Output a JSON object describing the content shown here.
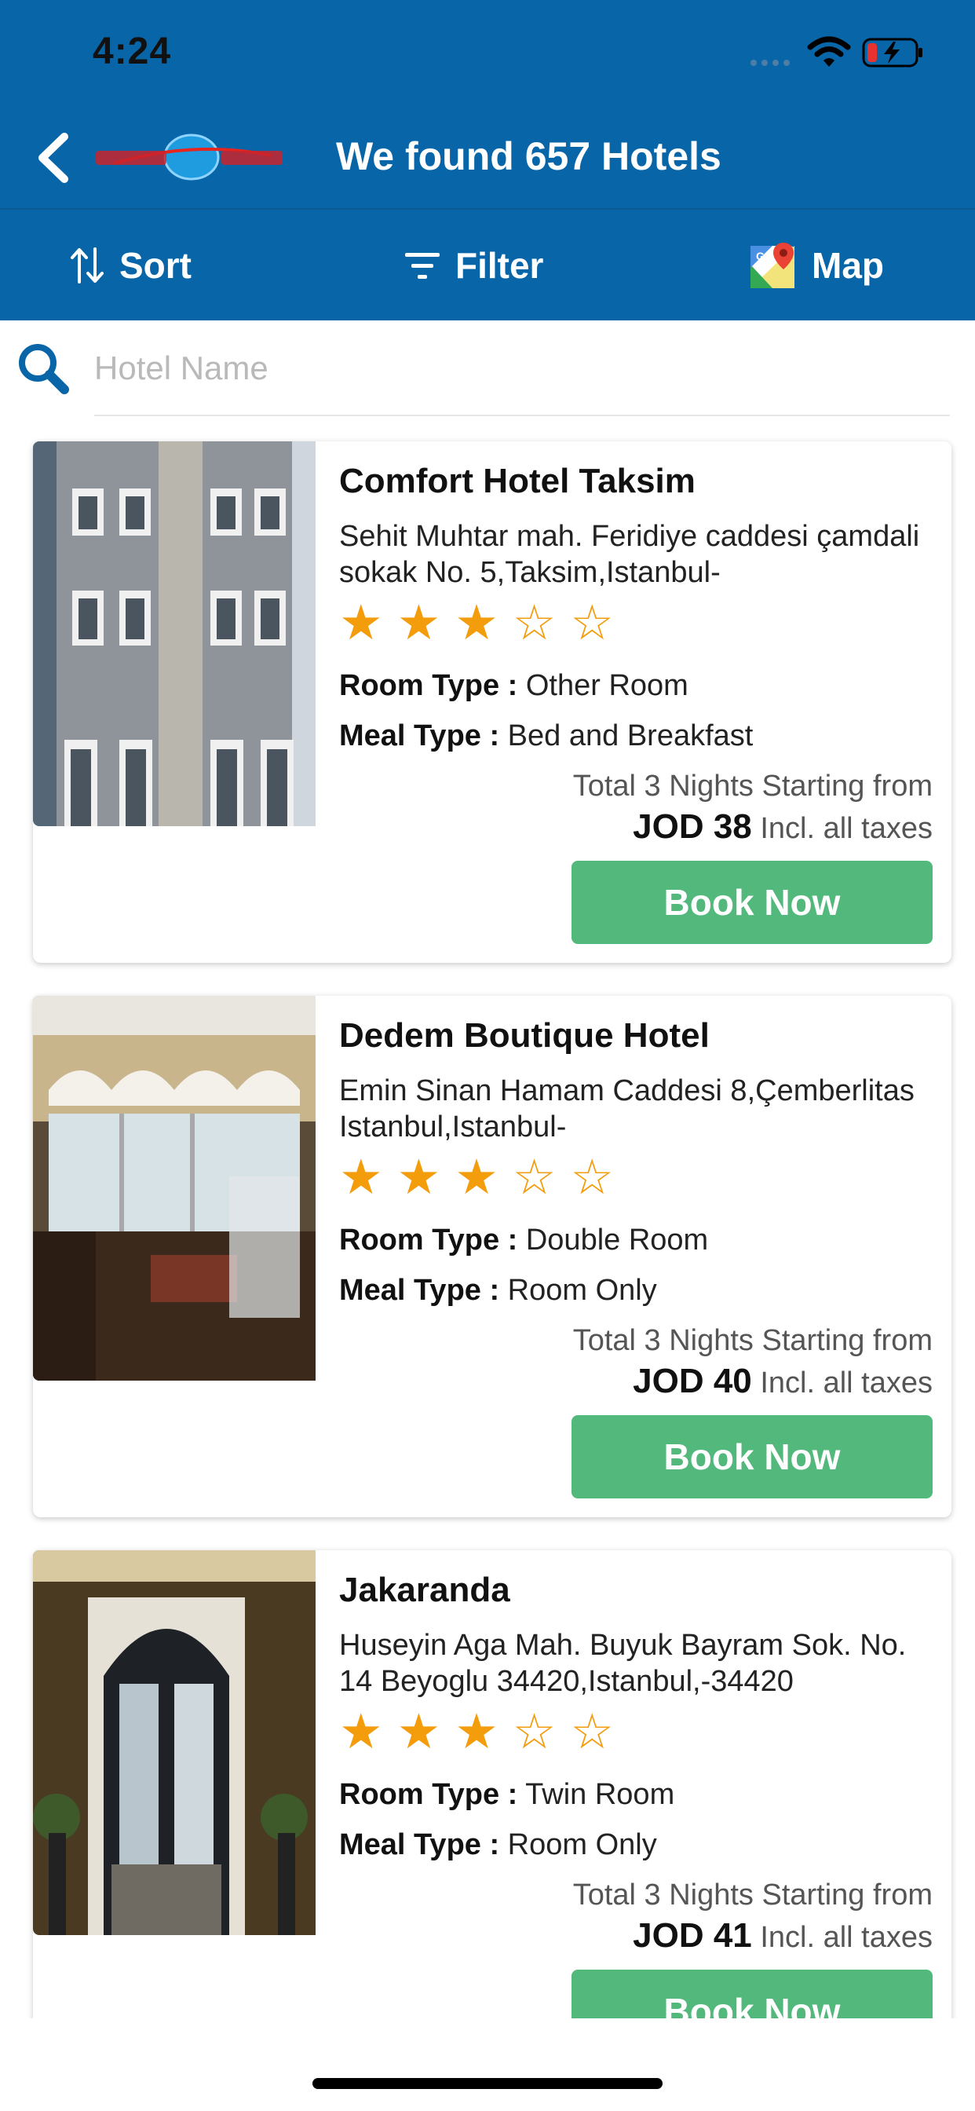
{
  "status": {
    "time": "4:24"
  },
  "header": {
    "title": "We found 657 Hotels",
    "logo_alt": "Dallas"
  },
  "toolbar": {
    "sort": "Sort",
    "filter": "Filter",
    "map": "Map"
  },
  "search": {
    "placeholder": "Hotel Name",
    "value": ""
  },
  "colors": {
    "brand": "#0765a8",
    "book_button": "#52b87b",
    "star": "#f39c0c"
  },
  "hotels": [
    {
      "name": "Comfort Hotel Taksim",
      "address": "Sehit Muhtar mah. Feridiye caddesi çamdali sokak No. 5,Taksim,Istanbul-",
      "stars": 3,
      "room_label": "Room Type :",
      "room_value": " Other Room",
      "meal_label": "Meal Type :",
      "meal_value": " Bed and Breakfast",
      "price_note": "Total 3 Nights Starting from",
      "price": "JOD 38",
      "tax_note": " Incl. all taxes",
      "book_label": "Book Now"
    },
    {
      "name": "Dedem Boutique Hotel",
      "address": "Emin Sinan Hamam Caddesi 8,Çemberlitas Istanbul,Istanbul-",
      "stars": 3,
      "room_label": "Room Type :",
      "room_value": " Double Room",
      "meal_label": "Meal Type :",
      "meal_value": " Room Only",
      "price_note": "Total 3 Nights Starting from",
      "price": "JOD 40",
      "tax_note": " Incl. all taxes",
      "book_label": "Book Now"
    },
    {
      "name": "Jakaranda",
      "address": "Huseyin Aga Mah. Buyuk Bayram Sok. No. 14 Beyoglu 34420,Istanbul,-34420",
      "stars": 3,
      "room_label": "Room Type :",
      "room_value": " Twin Room",
      "meal_label": "Meal Type :",
      "meal_value": " Room Only",
      "price_note": "Total 3 Nights Starting from",
      "price": "JOD 41",
      "tax_note": " Incl. all taxes",
      "book_label": "Book Now"
    }
  ]
}
